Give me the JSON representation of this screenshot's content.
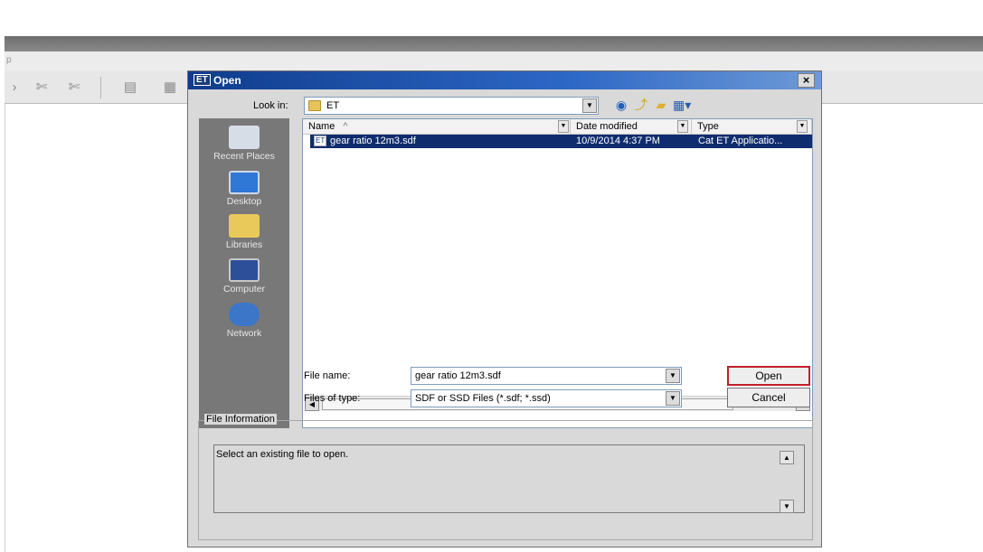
{
  "app": {
    "menu_text": "p"
  },
  "dialog": {
    "title_icon_text": "ET",
    "title": "Open",
    "close_glyph": "×",
    "look_in_label": "Look in:",
    "look_in_value": "ET",
    "places": [
      {
        "label": "Recent Places",
        "icon": "recent-places-icon"
      },
      {
        "label": "Desktop",
        "icon": "desktop-icon"
      },
      {
        "label": "Libraries",
        "icon": "libraries-icon"
      },
      {
        "label": "Computer",
        "icon": "computer-icon"
      },
      {
        "label": "Network",
        "icon": "network-icon"
      }
    ],
    "columns": {
      "name": "Name",
      "date": "Date modified",
      "type": "Type"
    },
    "files": [
      {
        "icon_text": "ET",
        "name": "gear ratio 12m3.sdf",
        "date": "10/9/2014 4:37 PM",
        "type": "Cat ET Applicatio..."
      }
    ],
    "file_name_label": "File name:",
    "file_name_value": "gear ratio 12m3.sdf",
    "file_type_label": "Files of type:",
    "file_type_value": "SDF or SSD Files (*.sdf; *.ssd)",
    "open_button": "Open",
    "cancel_button": "Cancel",
    "info_legend": "File Information",
    "info_text": "Select an existing file to open."
  }
}
